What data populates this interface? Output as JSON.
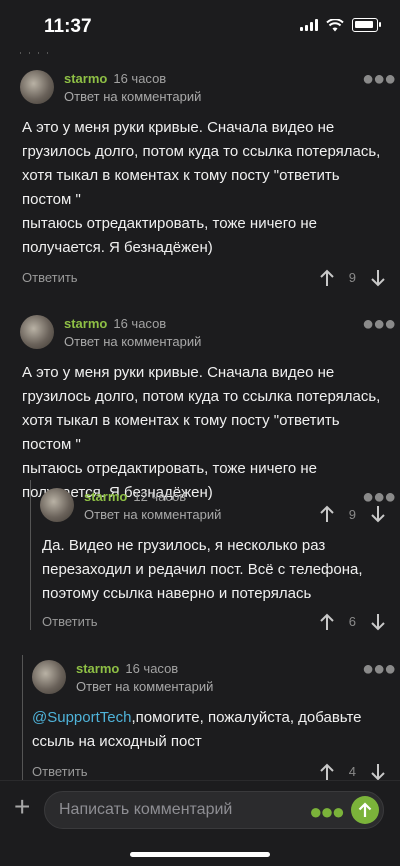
{
  "status_bar": {
    "time": "11:37"
  },
  "comments": [
    {
      "author": "starmo",
      "timestamp": "16 часов",
      "reply_to": "Ответ на комментарий",
      "body": "А это у меня руки кривые. Сначала видео не грузилось долго, потом куда то ссылка потерялась, хотя тыкал в коментах к тому посту \"ответить постом \"\nпытаюсь отредактировать, тоже ничего не получается. Я безнадёжен)",
      "reply_label": "Ответить",
      "score": "9"
    },
    {
      "author": "starmo",
      "timestamp": "16 часов",
      "reply_to": "Ответ на комментарий",
      "body": "А это у меня руки кривые. Сначала видео не грузилось долго, потом куда то ссылка потерялась, хотя тыкал в коментах к тому посту \"ответить постом \"\nпытаюсь отредактировать, тоже ничего не получается. Я безнадёжен)",
      "reply_label": "Ответить",
      "score": "9"
    },
    {
      "author": "starmo",
      "timestamp": "12 часов",
      "reply_to": "Ответ на комментарий",
      "body": "Да. Видео не грузилось, я несколько раз перезаходил и редачил пост. Всё с телефона, поэтому ссылка наверно и потерялась",
      "reply_label": "Ответить",
      "score": "6"
    },
    {
      "author": "starmo",
      "timestamp": "16 часов",
      "reply_to": "Ответ на комментарий",
      "mention": "@SupportTech",
      "body_rest": ",помогите, пожалуйста, добавьте ссыль на исходный пост",
      "reply_label": "Ответить",
      "score": "4"
    }
  ],
  "compose": {
    "placeholder": "Написать комментарий"
  },
  "colors": {
    "accent": "#7bb33a",
    "author": "#8ebf45",
    "mention": "#4fb3d9",
    "background": "#1c1c1e"
  }
}
